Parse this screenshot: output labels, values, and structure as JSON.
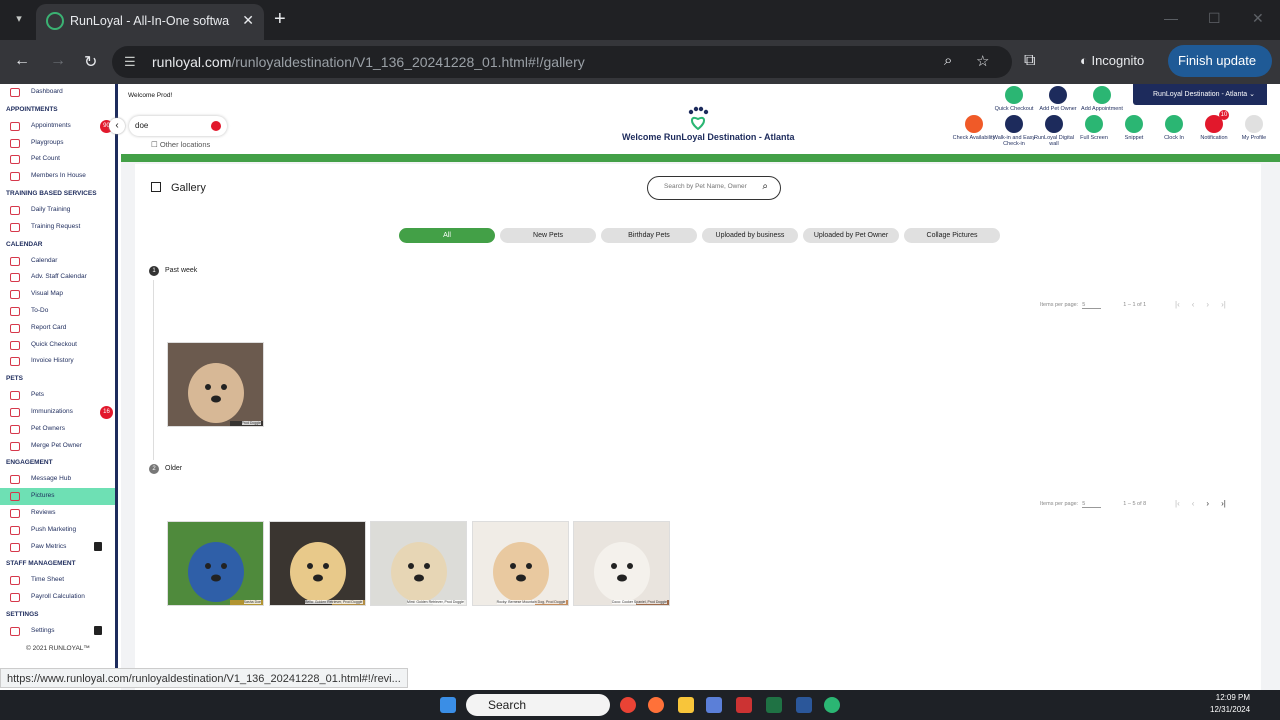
{
  "browser": {
    "tab_title": "RunLoyal - All-In-One software",
    "url_main": "runloyal.com",
    "url_path": "/runloyaldestination/V1_136_20241228_01.html#!/gallery",
    "incognito_label": "Incognito",
    "finish_update_label": "Finish update",
    "status_url": "https://www.runloyal.com/runloyaldestination/V1_136_20241228_01.html#!/revi..."
  },
  "sidebar": {
    "sections": [
      {
        "heading": "",
        "items": [
          {
            "label": "Dashboard"
          }
        ]
      },
      {
        "heading": "APPOINTMENTS",
        "items": [
          {
            "label": "Appointments",
            "badge": "90"
          },
          {
            "label": "Playgroups"
          },
          {
            "label": "Pet Count"
          },
          {
            "label": "Members In House"
          }
        ]
      },
      {
        "heading": "TRAINING BASED SERVICES",
        "items": [
          {
            "label": "Daily Training"
          },
          {
            "label": "Training Request"
          }
        ]
      },
      {
        "heading": "CALENDAR",
        "items": [
          {
            "label": "Calendar"
          },
          {
            "label": "Adv. Staff Calendar"
          },
          {
            "label": "Visual Map"
          },
          {
            "label": "To-Do"
          },
          {
            "label": "Report Card"
          },
          {
            "label": "Quick Checkout"
          },
          {
            "label": "Invoice History"
          }
        ]
      },
      {
        "heading": "PETS",
        "items": [
          {
            "label": "Pets"
          },
          {
            "label": "Immunizations",
            "badge": "16"
          },
          {
            "label": "Pet Owners"
          },
          {
            "label": "Merge Pet Owner"
          }
        ]
      },
      {
        "heading": "ENGAGEMENT",
        "items": [
          {
            "label": "Message Hub"
          },
          {
            "label": "Pictures",
            "active": true
          },
          {
            "label": "Reviews"
          },
          {
            "label": "Push Marketing"
          },
          {
            "label": "Paw Metrics",
            "locked": true
          }
        ]
      },
      {
        "heading": "STAFF MANAGEMENT",
        "items": [
          {
            "label": "Time Sheet"
          },
          {
            "label": "Payroll Calculation"
          }
        ]
      },
      {
        "heading": "SETTINGS",
        "items": [
          {
            "label": "Settings",
            "locked": true
          }
        ]
      }
    ],
    "footer": "© 2021  RUNLOYAL™"
  },
  "header": {
    "welcome_user": "Welcome Prod!",
    "search_value": "doe",
    "other_locations": "Other locations",
    "welcome_location": "Welcome RunLoyal Destination - Atlanta",
    "location_selector": "RunLoyal Destination - Atlanta",
    "top_actions": [
      {
        "label": "Quick Checkout",
        "color": "#2bb673"
      },
      {
        "label": "Add Pet Owner",
        "color": "#1d2b5c"
      },
      {
        "label": "Add Appointment",
        "color": "#2bb673"
      }
    ],
    "actions": [
      {
        "label": "Check Availability",
        "color": "#f05a28"
      },
      {
        "label": "Walk-in and Easy Check-in",
        "color": "#1d2b5c"
      },
      {
        "label": "RunLoyal Digital wall",
        "color": "#1d2b5c"
      },
      {
        "label": "Full Screen",
        "color": "#2bb673"
      },
      {
        "label": "Snippet",
        "color": "#2bb673"
      },
      {
        "label": "Clock In",
        "color": "#2bb673"
      },
      {
        "label": "Notification",
        "color": "#e2182c",
        "badge": "10"
      },
      {
        "label": "My Profile",
        "color": "#e0e0e0"
      }
    ]
  },
  "gallery": {
    "title": "Gallery",
    "search_placeholder": "Search by Pet Name, Owner",
    "filters": [
      "All",
      "New Pets",
      "Birthday Pets",
      "Uploaded by business",
      "Uploaded by Pet Owner",
      "Collage Pictures"
    ],
    "active_filter": "All",
    "groups": [
      {
        "step": "1",
        "label": "Past week",
        "items_per_page_label": "Items per page:",
        "items_per_page": "5",
        "range": "1 – 1 of 1",
        "photos": [
          "Prod Doggie"
        ]
      },
      {
        "step": "2",
        "label": "Older",
        "items_per_page_label": "Items per page:",
        "items_per_page": "5",
        "range": "1 – 5 of 8",
        "photos": [
          "Sasha Doe",
          "Bella: Golden Retriever, Prod Doggie",
          "Mimi: Golden Retriever, Prod Doggie",
          "Rocky: Bernese Mountain Dog, Prod Doggie",
          "Coco: Cocker Spaniel, Prod Doggie"
        ]
      }
    ]
  },
  "taskbar": {
    "search_label": "Search",
    "time": "12:09 PM",
    "date": "12/31/2024"
  }
}
